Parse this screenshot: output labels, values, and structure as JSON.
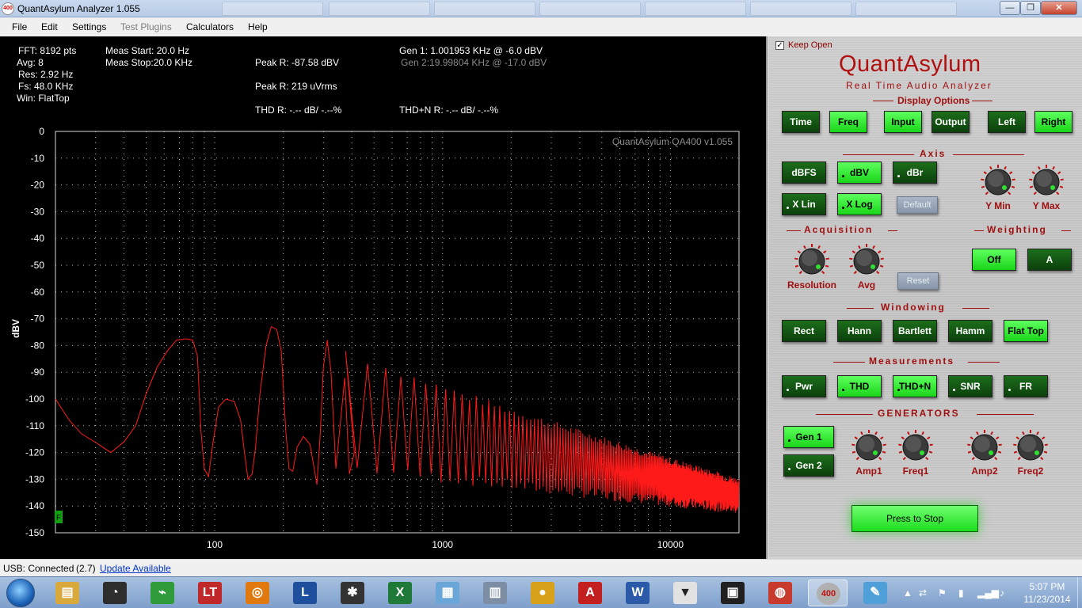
{
  "window": {
    "title": "QuantAsylum Analyzer 1.055",
    "minimize": "—",
    "maximize": "❐",
    "close": "✕"
  },
  "menu": [
    {
      "label": "File",
      "enabled": true
    },
    {
      "label": "Edit",
      "enabled": true
    },
    {
      "label": "Settings",
      "enabled": true
    },
    {
      "label": "Test Plugins",
      "enabled": false
    },
    {
      "label": "Calculators",
      "enabled": true
    },
    {
      "label": "Help",
      "enabled": true
    }
  ],
  "readouts": {
    "fft": "FFT: 8192 pts",
    "avg": "Avg: 8",
    "res": "Res: 2.92 Hz",
    "fs": "Fs: 48.0 KHz",
    "win": "Win: FlatTop",
    "meas_start": "Meas Start: 20.0 Hz",
    "meas_stop": "Meas Stop:20.0 KHz",
    "peak_dbv": "Peak R: -87.58 dBV",
    "peak_uvrms": "Peak R: 219 uVrms",
    "thd": "THD R: -.-- dB/ -.--%",
    "gen1": "Gen 1: 1.001953 KHz @ -6.0  dBV",
    "gen2": "Gen 2:19.99804 KHz @ -17.0  dBV",
    "thdn": "THD+N R: -.-- dB/ -.--%"
  },
  "plot": {
    "watermark": "QuantAsylum QA400 v1.055",
    "marker": "F"
  },
  "chart_data": {
    "type": "line",
    "title": "",
    "xlabel": "",
    "ylabel": "dBV",
    "xscale": "log",
    "xlim": [
      20,
      20000
    ],
    "ylim": [
      -150,
      0
    ],
    "grid": true,
    "y_ticks": [
      "0",
      "-10",
      "-20",
      "-30",
      "-40",
      "-50",
      "-60",
      "-70",
      "-80",
      "-90",
      "-100",
      "-110",
      "-120",
      "-130",
      "-140",
      "-150"
    ],
    "x_ticks": [
      {
        "value": 100,
        "label": "100"
      },
      {
        "value": 1000,
        "label": "1000"
      },
      {
        "value": 10000,
        "label": "10000"
      }
    ],
    "series": [
      {
        "color": "#ff1a1a",
        "fundamental_hz": 93.75,
        "points": [
          [
            20,
            -100
          ],
          [
            23,
            -108
          ],
          [
            26,
            -113
          ],
          [
            31,
            -117
          ],
          [
            35,
            -120
          ],
          [
            40,
            -116
          ],
          [
            45,
            -110
          ],
          [
            50,
            -98
          ],
          [
            56,
            -88
          ],
          [
            62,
            -82
          ],
          [
            68,
            -78
          ],
          [
            75,
            -77.5
          ],
          [
            80,
            -78
          ],
          [
            84,
            -84
          ],
          [
            87,
            -112
          ],
          [
            90,
            -126
          ],
          [
            94,
            -129
          ],
          [
            98,
            -117
          ],
          [
            104,
            -103
          ],
          [
            112,
            -100
          ],
          [
            122,
            -101
          ],
          [
            130,
            -108
          ],
          [
            135,
            -120
          ],
          [
            140,
            -130
          ],
          [
            146,
            -128
          ],
          [
            151,
            -118
          ],
          [
            158,
            -98
          ],
          [
            168,
            -80
          ],
          [
            177,
            -73
          ],
          [
            187,
            -74
          ],
          [
            196,
            -82
          ],
          [
            205,
            -112
          ],
          [
            212,
            -126
          ],
          [
            220,
            -127
          ],
          [
            230,
            -118
          ],
          [
            245,
            -114
          ],
          [
            262,
            -117
          ],
          [
            272,
            -125
          ],
          [
            281,
            -132
          ],
          [
            290,
            -114
          ],
          [
            300,
            -88
          ],
          [
            312,
            -78
          ],
          [
            324,
            -90
          ],
          [
            340,
            -126
          ],
          [
            355,
            -110
          ],
          [
            372,
            -92
          ],
          [
            390,
            -128
          ],
          [
            410,
            -120
          ]
        ],
        "harmonic_peaks": {
          "start_hz": 375,
          "step_hz": 93.75,
          "peak_db_start": -82,
          "peak_db_end": -131,
          "floor_db_start": -126,
          "floor_db_end": -141,
          "end_hz": 20000
        }
      }
    ]
  },
  "panel": {
    "keep_open": "Keep Open",
    "keep_open_check": "✓",
    "brand": "QuantAsylum",
    "tagline": "Real Time Audio Analyzer",
    "sections": {
      "display": "Display Options",
      "axis": "Axis",
      "acquisition": "Acquisition",
      "weighting": "Weighting",
      "windowing": "Windowing",
      "measurements": "Measurements",
      "generators": "GENERATORS"
    },
    "display_buttons": [
      {
        "label": "Time",
        "state": "off"
      },
      {
        "label": "Freq",
        "state": "on"
      },
      {
        "label": "Input",
        "state": "on"
      },
      {
        "label": "Output",
        "state": "off"
      },
      {
        "label": "Left",
        "state": "off"
      },
      {
        "label": "Right",
        "state": "on"
      }
    ],
    "axis_buttons": [
      {
        "label": "dBFS",
        "state": "off"
      },
      {
        "label": "dBV",
        "state": "on"
      },
      {
        "label": "dBr",
        "state": "off"
      },
      {
        "label": "X Lin",
        "state": "off"
      },
      {
        "label": "X Log",
        "state": "on"
      },
      {
        "label": "Default",
        "state": "disabled"
      }
    ],
    "axis_knobs": [
      "Y Min",
      "Y Max"
    ],
    "acq_knobs": [
      "Resolution",
      "Avg"
    ],
    "acq_reset": "Reset",
    "weighting_buttons": [
      {
        "label": "Off",
        "state": "on"
      },
      {
        "label": "A",
        "state": "off"
      }
    ],
    "window_buttons": [
      {
        "label": "Rect",
        "state": "off"
      },
      {
        "label": "Hann",
        "state": "off"
      },
      {
        "label": "Bartlett",
        "state": "off"
      },
      {
        "label": "Hamm",
        "state": "off"
      },
      {
        "label": "Flat Top",
        "state": "on"
      }
    ],
    "measure_buttons": [
      {
        "label": "Pwr",
        "state": "off"
      },
      {
        "label": "THD",
        "state": "on"
      },
      {
        "label": "THD+N",
        "state": "on"
      },
      {
        "label": "SNR",
        "state": "off"
      },
      {
        "label": "FR",
        "state": "off"
      }
    ],
    "gen_buttons": [
      {
        "label": "Gen 1",
        "state": "on"
      },
      {
        "label": "Gen 2",
        "state": "off"
      }
    ],
    "gen_knobs": [
      "Amp1",
      "Freq1",
      "Amp2",
      "Freq2"
    ],
    "stop_button": "Press to Stop"
  },
  "status": {
    "usb": "USB: Connected",
    "version": "(2.7)",
    "update": "Update Available"
  },
  "taskbar": {
    "apps": [
      {
        "icon": "folder-icon",
        "glyph": "▤",
        "color": "#d9a93c"
      },
      {
        "icon": "meter-app-icon",
        "glyph": "◔",
        "color": "#2d2d2d"
      },
      {
        "icon": "pcb-app-icon",
        "glyph": "⌁",
        "color": "#2f9b3a"
      },
      {
        "icon": "ltspice-icon",
        "glyph": "LT",
        "color": "#c0282a"
      },
      {
        "icon": "audacity-icon",
        "glyph": "◎",
        "color": "#e07a10"
      },
      {
        "icon": "labview-icon",
        "glyph": "L",
        "color": "#1d4f9c"
      },
      {
        "icon": "inkscape-icon",
        "glyph": "✱",
        "color": "#333333"
      },
      {
        "icon": "excel-icon",
        "glyph": "X",
        "color": "#1f7a3a"
      },
      {
        "icon": "notepad-icon",
        "glyph": "▦",
        "color": "#6aa7d8"
      },
      {
        "icon": "calculator-icon",
        "glyph": "▥",
        "color": "#7d8da3"
      },
      {
        "icon": "chrome-icon",
        "glyph": "●",
        "color": "#d7a11a"
      },
      {
        "icon": "acrobat-icon",
        "glyph": "A",
        "color": "#c31f1f"
      },
      {
        "icon": "word-icon",
        "glyph": "W",
        "color": "#2a5aa8"
      },
      {
        "icon": "fox-app-icon",
        "glyph": "▼",
        "color": "#e2e2e2"
      },
      {
        "icon": "chip-app-icon",
        "glyph": "▣",
        "color": "#202020"
      },
      {
        "icon": "vnc-app-icon",
        "glyph": "◍",
        "color": "#c83a2e"
      },
      {
        "icon": "qa400-icon",
        "glyph": "400",
        "color": "#b0b0b0"
      },
      {
        "icon": "paint-icon",
        "glyph": "✎",
        "color": "#4fa0d8"
      }
    ],
    "tray": [
      "▲",
      "⇄",
      "⚑",
      "▮",
      "▂▄▆",
      "♪"
    ],
    "time": "5:07 PM",
    "date": "11/23/2014"
  }
}
